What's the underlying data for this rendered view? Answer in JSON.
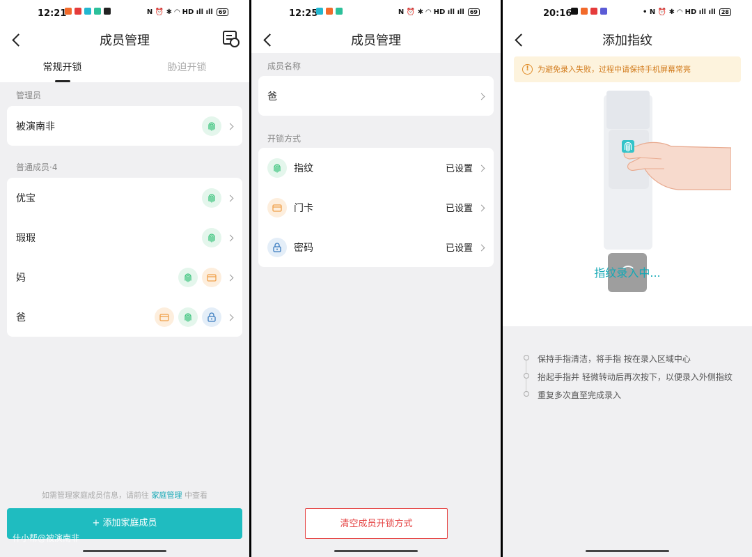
{
  "panel1": {
    "status_time": "12:21",
    "battery": "69",
    "title": "成员管理",
    "tabs": [
      "常规开锁",
      "胁迫开锁"
    ],
    "admin_section": "管理员",
    "admin_name": "被演南非",
    "members_section": "普通成员·4",
    "members": [
      {
        "name": "优宝",
        "icons": [
          "fingerprint"
        ]
      },
      {
        "name": "瑕瑕",
        "icons": [
          "fingerprint"
        ]
      },
      {
        "name": "妈",
        "icons": [
          "fingerprint",
          "card"
        ]
      },
      {
        "name": "爸",
        "icons": [
          "card",
          "fingerprint",
          "password"
        ]
      }
    ],
    "footer_prefix": "如需管理家庭成员信息，请前往",
    "footer_link": "家庭管理",
    "footer_suffix": "中查看",
    "add_button": "+ 添加家庭成员",
    "watermark": "什小帮@被演南非"
  },
  "panel2": {
    "status_time": "12:25",
    "battery": "69",
    "title": "成员管理",
    "name_section": "成员名称",
    "member_name": "爸",
    "unlock_section": "开锁方式",
    "methods": [
      {
        "label": "指纹",
        "status": "已设置",
        "icon": "fingerprint"
      },
      {
        "label": "门卡",
        "status": "已设置",
        "icon": "card"
      },
      {
        "label": "密码",
        "status": "已设置",
        "icon": "password"
      }
    ],
    "clear_button": "清空成员开锁方式"
  },
  "panel3": {
    "status_time": "20:16",
    "battery": "28",
    "title": "添加指纹",
    "notice": "为避免录入失败，过程中请保持手机屏幕常亮",
    "recording": "指纹录入中...",
    "tips": [
      "保持手指清洁，将手指 按在录入区域中心",
      "抬起手指并 轻微转动后再次按下，以便录入外侧指纹",
      "重复多次直至完成录入"
    ]
  },
  "colors": {
    "accent": "#1fbcc0",
    "link": "#14a8b5",
    "danger": "#e54545",
    "green_icon": "#3cc47d",
    "orange_icon": "#f0a04a",
    "blue_icon": "#3a7bbf"
  }
}
